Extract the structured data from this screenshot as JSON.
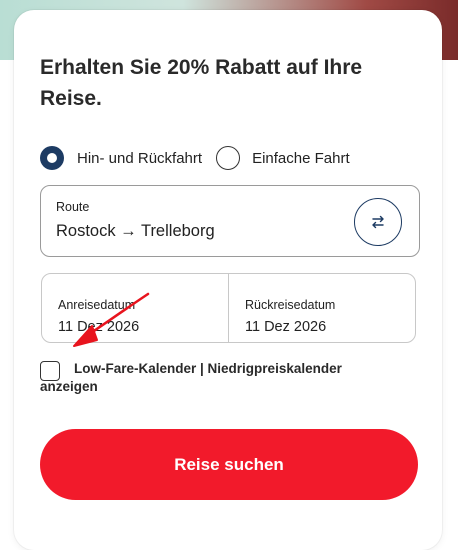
{
  "card": {
    "title": "Erhalten Sie 20% Rabatt auf Ihre Reise."
  },
  "trip_type": {
    "options": [
      {
        "label": "Hin- und Rückfahrt",
        "selected": true
      },
      {
        "label": "Einfache Fahrt",
        "selected": false
      }
    ]
  },
  "route": {
    "label": "Route",
    "value": "Rostock → Trelleborg",
    "swap_icon": "swap-arrows-icon"
  },
  "dates": {
    "outbound_label": "Anreisedatum",
    "outbound_value": "11 Dez 2026",
    "return_label": "Rückreisedatum",
    "return_value": "11 Dez 2026"
  },
  "low_fare": {
    "label": "Low-Fare-Kalender | Niedrigpreiskalender anzeigen",
    "checked": false
  },
  "search_button": {
    "label": "Reise suchen"
  },
  "colors": {
    "accent_navy": "#1d3b63",
    "cta_red": "#f21a2b",
    "annotation_red": "#e8141e"
  }
}
